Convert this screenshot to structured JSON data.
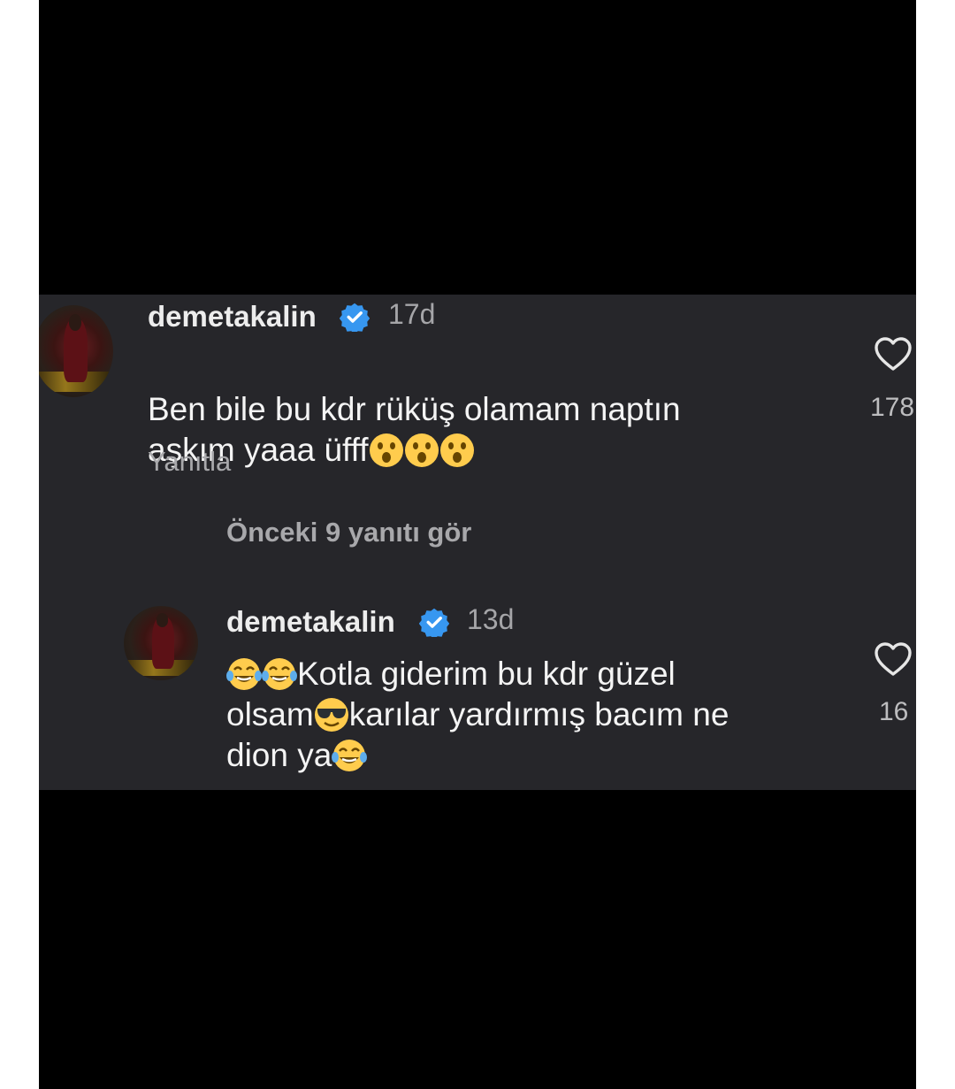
{
  "comments": [
    {
      "username": "demetakalin",
      "time": "17d",
      "text": "Ben bile bu kdr rüküş olamam naptın\naşkım yaaa üfff",
      "emojis_after": [
        "astonished-face",
        "astonished-face",
        "astonished-face"
      ],
      "reply_label": "Yanıtla",
      "likes": "178",
      "verified": true
    }
  ],
  "view_previous_replies": "Önceki 9 yanıtı gör",
  "replies": [
    {
      "username": "demetakalin",
      "time": "13d",
      "line1_text": "Kotla giderim bu kdr güzel",
      "line2_pre": "olsam",
      "line2_post": "karılar yardırmış bacım ne",
      "line3_pre": "dion ya",
      "emojis": [
        "tears-of-joy-face",
        "tears-of-joy-face",
        "sunglasses-face",
        "tears-of-joy-face"
      ],
      "likes": "16",
      "verified": true
    }
  ],
  "colors": {
    "panel_bg": "#26262a",
    "verified_blue": "#3797f0",
    "text_primary": "#f4f4f4",
    "text_secondary": "#a5a5a8"
  }
}
